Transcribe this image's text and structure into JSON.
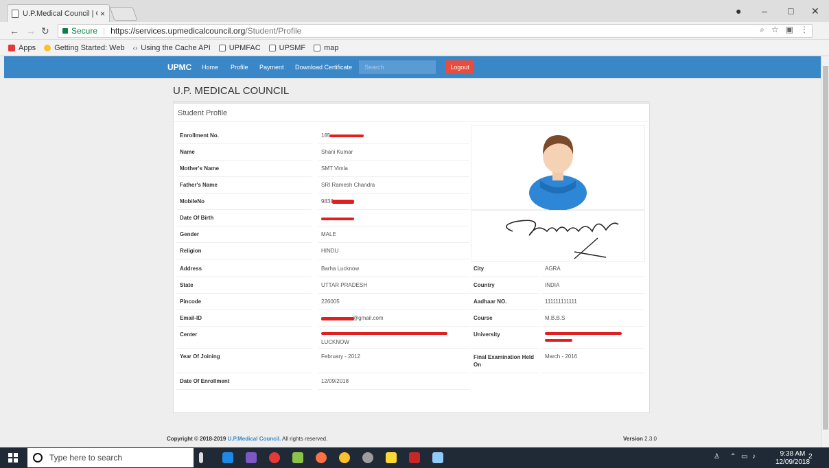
{
  "browser": {
    "tab_title": "U.P.Medical Council | Coll",
    "tab_close": "×",
    "secure_label": "Secure",
    "url_host": "https://services.upmedicalcouncil.org",
    "url_path": "/Student/Profile",
    "bookmarks": [
      {
        "label": "Apps",
        "icon": "apps-grid-icon",
        "color": "#e53935"
      },
      {
        "label": "Getting Started: Web",
        "icon": "chrome-icon",
        "color": "#fbc02d"
      },
      {
        "label": "Using the Cache API",
        "icon": "code-icon",
        "color": "#555555"
      },
      {
        "label": "UPMFAC",
        "icon": "page-icon",
        "color": "#ffffff"
      },
      {
        "label": "UPSMF",
        "icon": "page-icon",
        "color": "#ffffff"
      },
      {
        "label": "map",
        "icon": "page-icon",
        "color": "#ffffff"
      }
    ]
  },
  "navbar": {
    "brand": "UPMC",
    "links": [
      "Home",
      "Profile",
      "Payment",
      "Download Certificate"
    ],
    "search_placeholder": "Search",
    "logout": "Logout",
    "color": "#3a87c8"
  },
  "page": {
    "title": "U.P. MEDICAL COUNCIL",
    "panel_heading": "Student Profile"
  },
  "profile": {
    "enrollment_label": "Enrollment No.",
    "enrollment_value": "185",
    "name_label": "Name",
    "name_value": "Shani Kumar",
    "mother_label": "Mother's Name",
    "mother_value": "SMT Vimla",
    "father_label": "Father's Name",
    "father_value": "SRI Ramesh Chandra",
    "mobile_label": "MobileNo",
    "mobile_value": "9838",
    "dob_label": "Date Of Birth",
    "dob_value": "",
    "gender_label": "Gender",
    "gender_value": "MALE",
    "religion_label": "Religion",
    "religion_value": "HINDU",
    "address_label": "Address",
    "address_value": "Barha Lucknow",
    "city_label": "City",
    "city_value": "AGRA",
    "state_label": "State",
    "state_value": "UTTAR PRADESH",
    "country_label": "Country",
    "country_value": "INDIA",
    "pincode_label": "Pincode",
    "pincode_value": "226005",
    "aadhaar_label": "Aadhaar NO.",
    "aadhaar_value": "111111111111",
    "email_label": "Email-ID",
    "email_value": "@gmail.com",
    "course_label": "Course",
    "course_value": "M.B.B.S",
    "center_label": "Center",
    "center_value": "LUCKNOW",
    "university_label": "University",
    "university_value": "",
    "yoj_label": "Year Of Joining",
    "yoj_value": "February - 2012",
    "final_label": "Final Examination Held On",
    "final_value": "March - 2016",
    "doe_label": "Date Of Enrollment",
    "doe_value": "12/09/2018"
  },
  "footer": {
    "copyright_prefix": "Copyright © 2018-2019",
    "org": "U.P.Medical Council.",
    "rights": "All rights reserved.",
    "version_label": "Version",
    "version_value": "2.3.0"
  },
  "taskbar": {
    "search_placeholder": "Type here to search",
    "time": "9:38 AM",
    "date": "12/09/2018",
    "notification_count": "2"
  },
  "colors": {
    "redaction": "#e02020",
    "logout": "#e74c3c",
    "secure": "#0b8043"
  }
}
